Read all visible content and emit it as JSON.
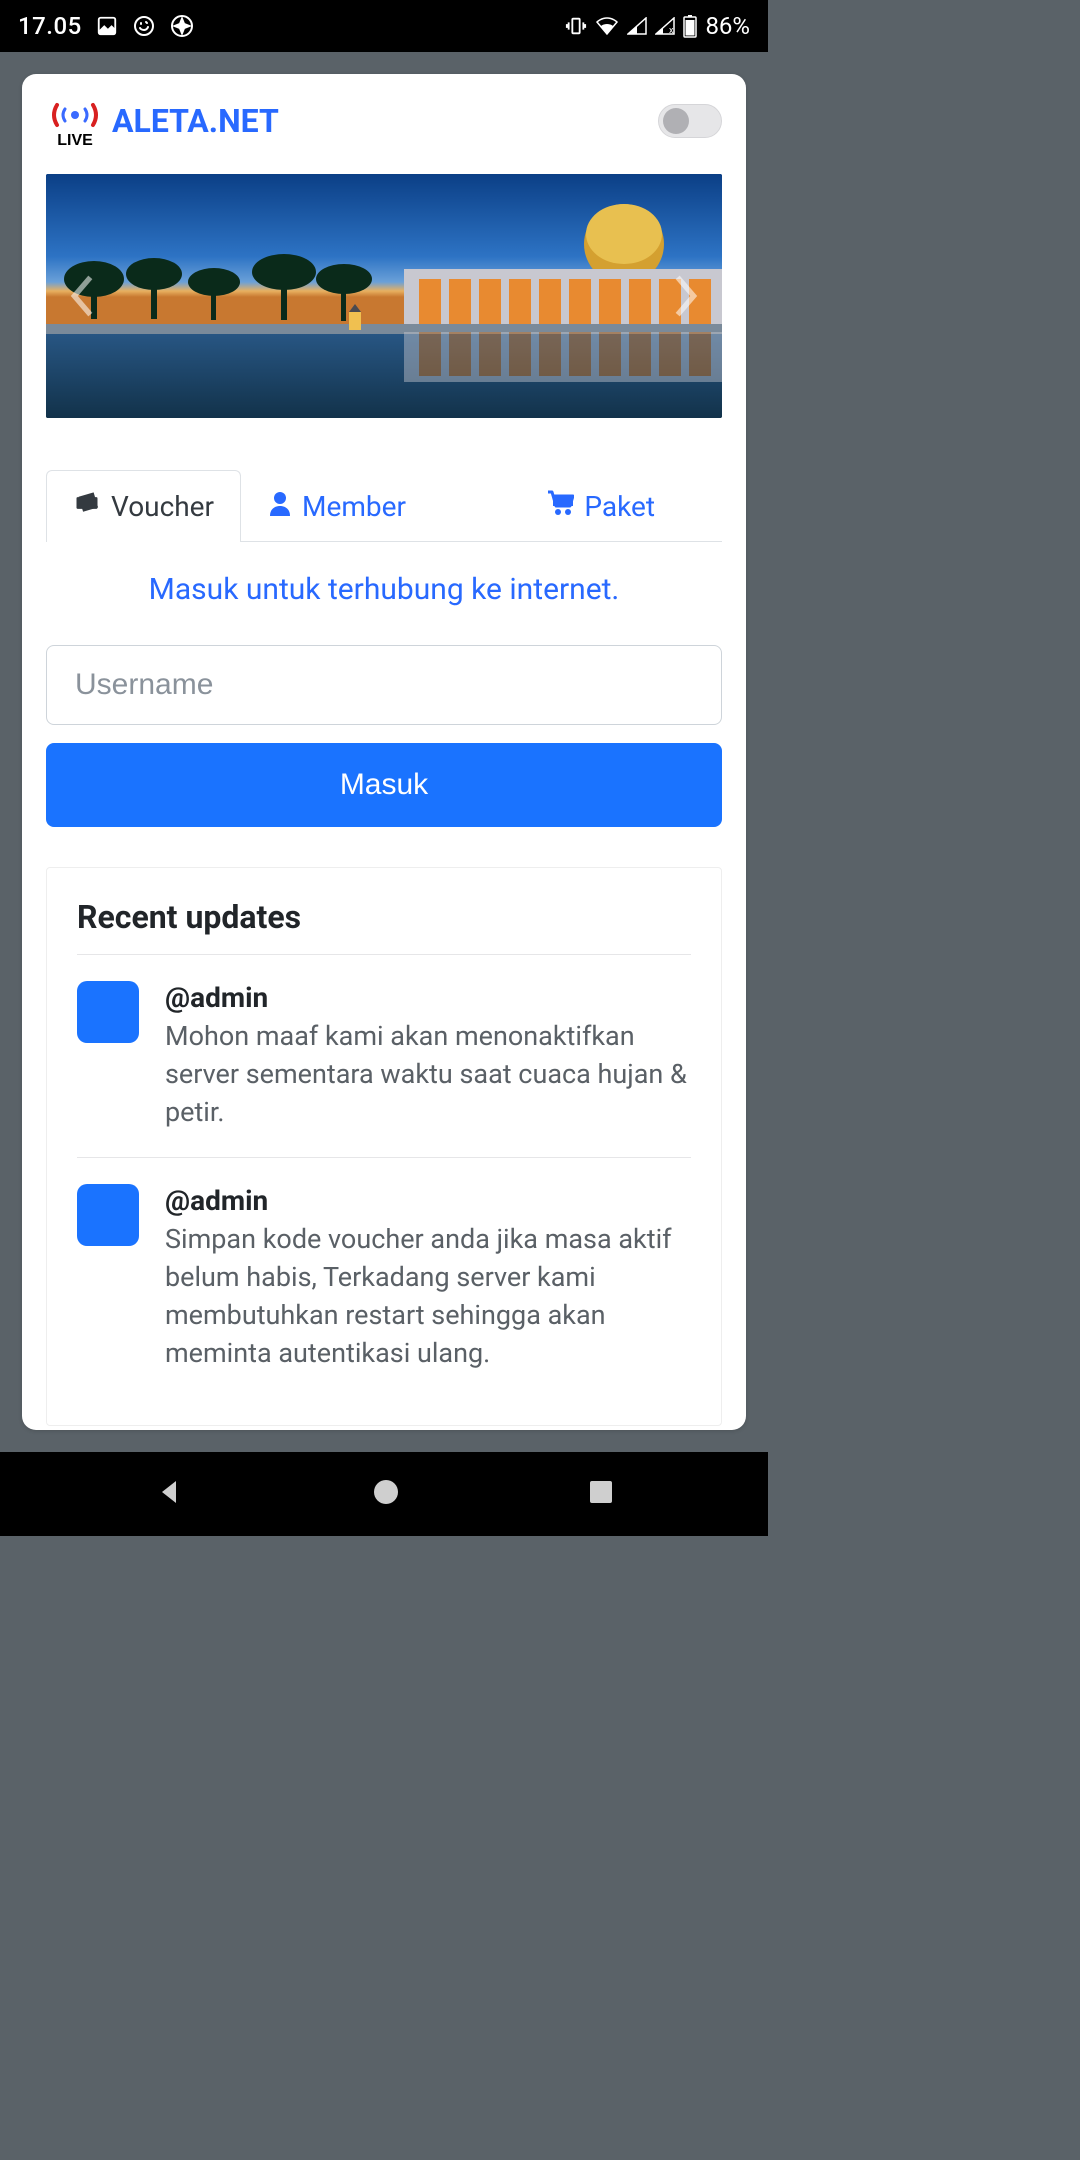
{
  "status": {
    "time": "17.05",
    "battery_pct": "86%"
  },
  "brand": {
    "title": "ALETA.NET",
    "logo_caption": "LIVE"
  },
  "tabs": [
    {
      "label": "Voucher",
      "icon": "ticket-icon"
    },
    {
      "label": "Member",
      "icon": "user-icon"
    },
    {
      "label": "Paket",
      "icon": "cart-icon"
    }
  ],
  "login": {
    "heading": "Masuk untuk terhubung ke internet.",
    "username_placeholder": "Username",
    "submit_label": "Masuk"
  },
  "updates": {
    "title": "Recent updates",
    "items": [
      {
        "author": "@admin",
        "text": "Mohon maaf kami akan menonaktifkan server sementara waktu saat cuaca hujan & petir."
      },
      {
        "author": "@admin",
        "text": "Simpan kode voucher anda jika masa aktif belum habis, Terkadang server kami membutuhkan restart sehingga akan meminta autentikasi ulang."
      }
    ]
  },
  "colors": {
    "primary": "#1a73ff",
    "link": "#2869ff"
  }
}
